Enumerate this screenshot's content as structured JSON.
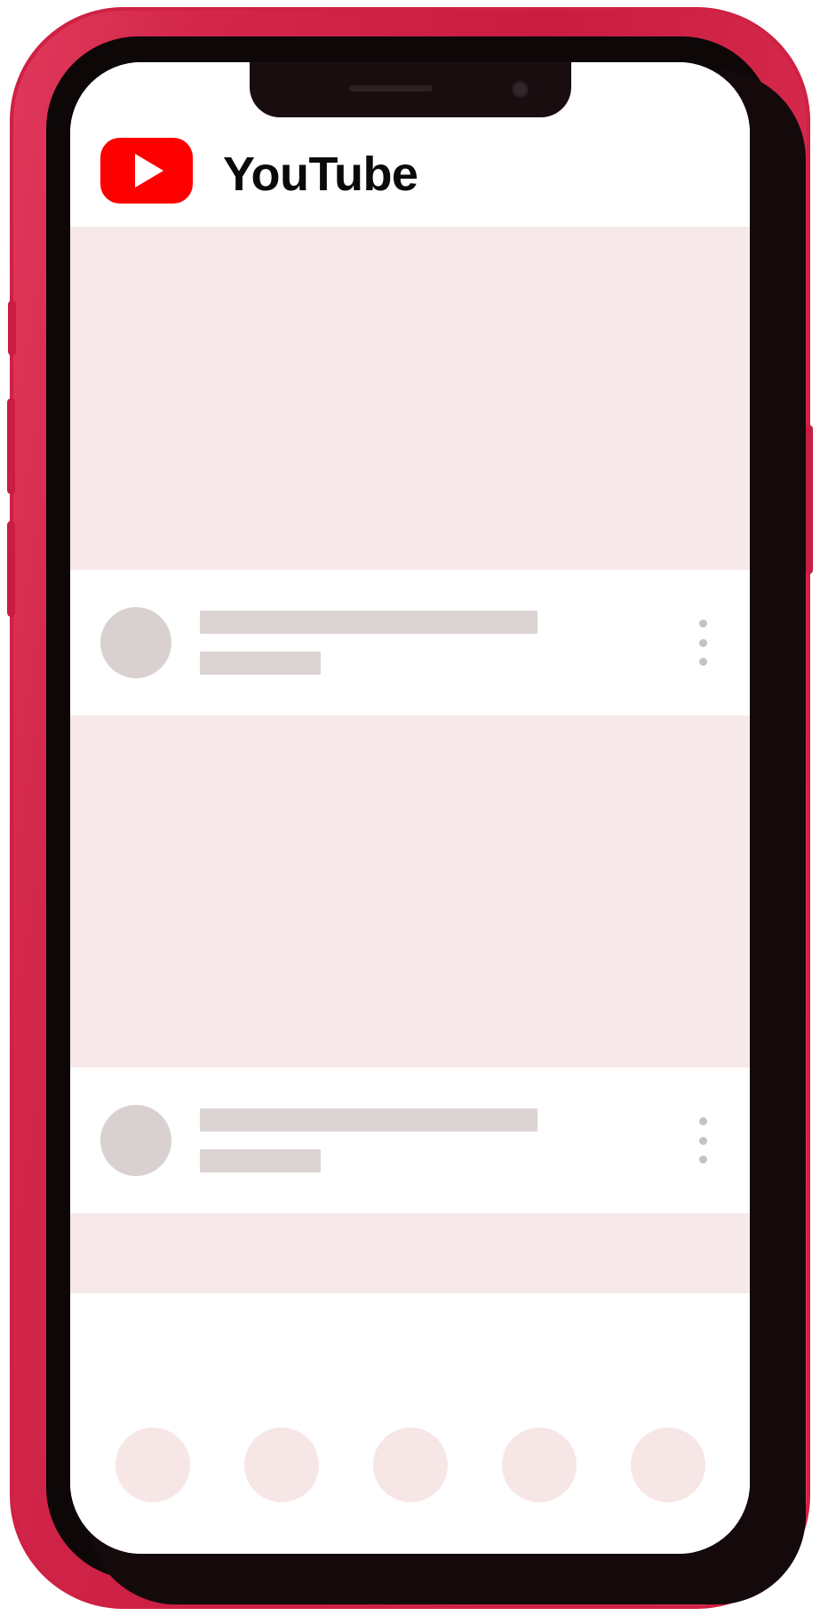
{
  "device": {
    "type": "smartphone-mockup",
    "shell_color": "#cf2144",
    "frame_color": "#140a0c",
    "screen_color": "#ffffff",
    "notch": {
      "speaker_label": "earpiece-speaker",
      "camera_label": "front-camera"
    },
    "side_buttons": [
      "mute-switch",
      "volume-up",
      "volume-down",
      "power-button"
    ]
  },
  "app": {
    "name": "YouTube",
    "header": {
      "logo_icon": "youtube-play-icon",
      "logo_color": "#ff0000",
      "wordmark": "YouTube",
      "wordmark_color": "#0a0a0a"
    },
    "state": "loading-skeleton",
    "colors": {
      "thumbnail_placeholder": "#f7e9e9",
      "avatar_placeholder": "#d9d0d0",
      "text_placeholder": "#dcd3d3",
      "kebab_dot": "#c9c0c0",
      "tab_dot": "#f7e6e6"
    },
    "feed": {
      "items": [
        {
          "thumbnail_label": "video-thumbnail-placeholder",
          "avatar_label": "channel-avatar-placeholder",
          "title_label": "video-title-placeholder",
          "subtitle_label": "video-meta-placeholder",
          "menu_label": "more-options-menu"
        },
        {
          "thumbnail_label": "video-thumbnail-placeholder",
          "avatar_label": "channel-avatar-placeholder",
          "title_label": "video-title-placeholder",
          "subtitle_label": "video-meta-placeholder",
          "menu_label": "more-options-menu"
        }
      ],
      "partial_thumbnail_label": "video-thumbnail-placeholder-partial"
    },
    "tabbar": {
      "items": [
        {
          "icon": "home-icon"
        },
        {
          "icon": "shorts-icon"
        },
        {
          "icon": "create-icon"
        },
        {
          "icon": "subscriptions-icon"
        },
        {
          "icon": "library-icon"
        }
      ]
    }
  }
}
